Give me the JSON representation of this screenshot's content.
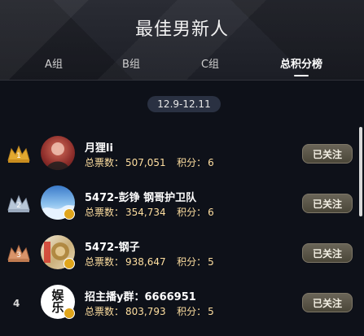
{
  "header": {
    "title": "最佳男新人"
  },
  "tabs": [
    {
      "label": "A组",
      "active": false
    },
    {
      "label": "B组",
      "active": false
    },
    {
      "label": "C组",
      "active": false
    },
    {
      "label": "总积分榜",
      "active": true
    }
  ],
  "date_range": "12.9-12.11",
  "list": [
    {
      "rank": 1,
      "name": "月狸li",
      "votes_label": "总票数：",
      "votes": "507,051",
      "points_label": "积分：",
      "points": "6",
      "follow": "已关注"
    },
    {
      "rank": 2,
      "name": "5472-彭铮 钢哥护卫队",
      "votes_label": "总票数：",
      "votes": "354,734",
      "points_label": "积分：",
      "points": "6",
      "follow": "已关注"
    },
    {
      "rank": 3,
      "name": "5472-钢子",
      "votes_label": "总票数：",
      "votes": "938,647",
      "points_label": "积分：",
      "points": "5",
      "follow": "已关注"
    },
    {
      "rank": 4,
      "name": "招主播y群：6666951",
      "votes_label": "总票数：",
      "votes": "803,793",
      "points_label": "积分：",
      "points": "5",
      "follow": "已关注",
      "avatar_text": [
        "娱",
        "乐"
      ]
    }
  ],
  "colors": {
    "gold": "#e2a830",
    "silver": "#b8c7d8",
    "bronze": "#d9946a",
    "stats": "#ffdfa0"
  },
  "icons": {
    "rank1": "crown-gold-icon",
    "rank2": "crown-silver-icon",
    "rank3": "crown-bronze-icon"
  }
}
